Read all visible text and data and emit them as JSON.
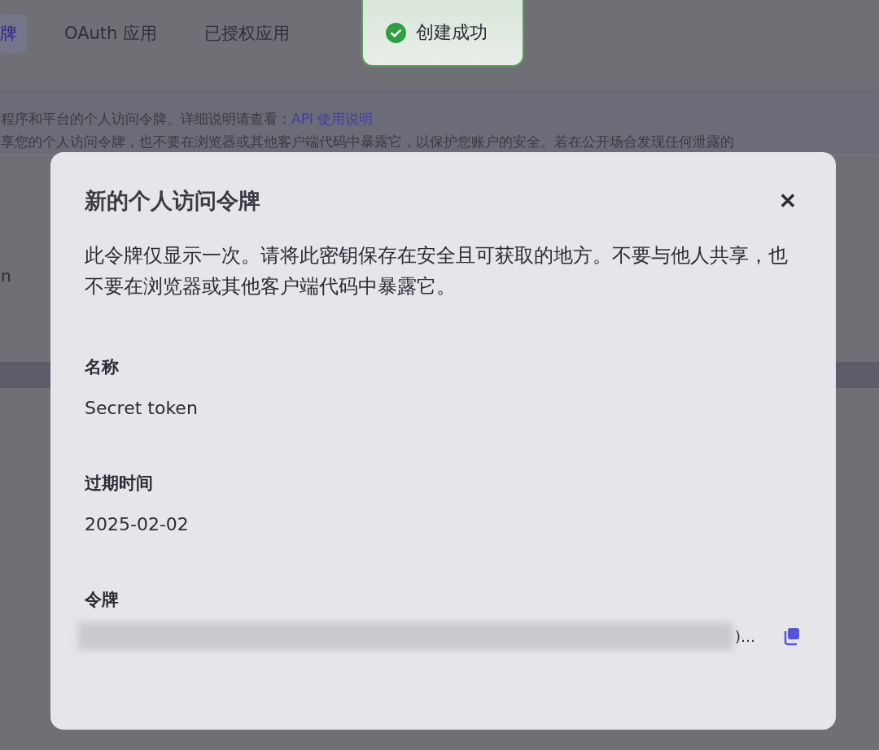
{
  "tabs": [
    {
      "label": "牌",
      "selected": true
    },
    {
      "label": "OAuth 应用",
      "selected": false
    },
    {
      "label": "已授权应用",
      "selected": false
    }
  ],
  "toast": {
    "kind": "success",
    "message": "创建成功"
  },
  "banner": {
    "line_1": "程序和平台的个人访问令牌。详细说明请查看：",
    "link": "API 使用说明",
    "line_2": "享您的个人访问令牌，也不要在浏览器或其他客户端代码中暴露它，以保护您账户的安全。若在公开场合发现任何泄露的"
  },
  "table": {
    "cell": "n"
  },
  "dialog": {
    "title": "新的个人访问令牌",
    "close": "✕",
    "description": "此令牌仅显示一次。请将此密钥保存在安全且可获取的地方。不要与他人共享，也不要在浏览器或其他客户端代码中暴露它。",
    "fields": [
      {
        "label": "名称",
        "value": "Secret token"
      },
      {
        "label": "过期时间",
        "value": "2025-02-02"
      }
    ],
    "token": {
      "label": "令牌",
      "visible_end": ")…"
    }
  }
}
